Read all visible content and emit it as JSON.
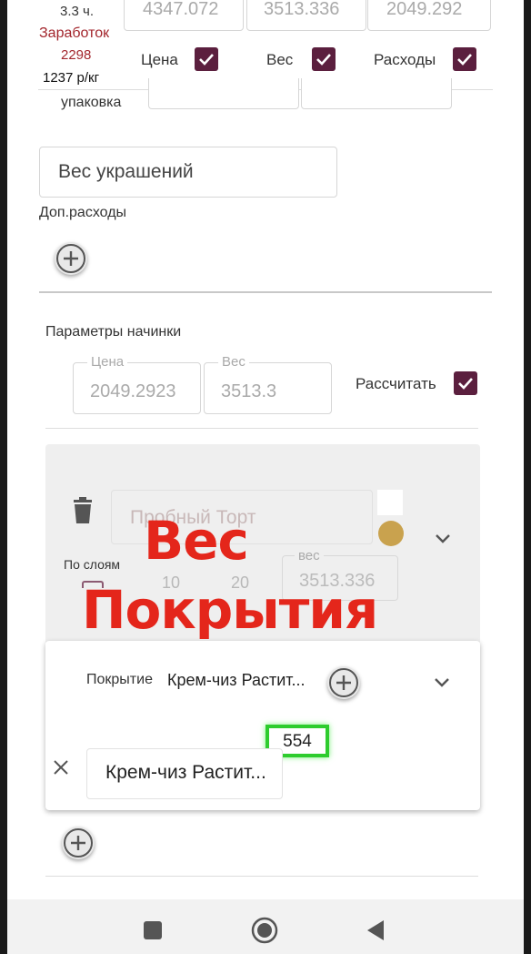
{
  "top": {
    "hours": "3.3 ч.",
    "earnings_label": "Заработок",
    "earnings_value": "2298",
    "price_per_kg": "1237 р/кг",
    "field_1": "4347.072",
    "field_2": "3513.336",
    "field_3": "2049.292",
    "check_price": "Цена",
    "check_weight": "Вес",
    "check_expenses": "Расходы",
    "packaging_label": "упаковка"
  },
  "decorations": {
    "placeholder": "Вес украшений",
    "extra_expenses_label": "Доп.расходы"
  },
  "filling": {
    "section_title": "Параметры начинки",
    "price_legend": "Цена",
    "price_value": "2049.2923",
    "weight_legend": "Вес",
    "weight_value": "3513.3",
    "calculate_label": "Рассчитать"
  },
  "cake_card": {
    "name": "Пробный Торт",
    "by_layers_label": "По слоям",
    "layer_a": "10",
    "layer_b": "20",
    "weight_legend": "вес",
    "weight_value": "3513.336",
    "accent_color": "#c9a24e"
  },
  "coating_card": {
    "label": "Покрытие",
    "selected": "Крем-чиз Растит...",
    "weight_badge": "554",
    "item_name": "Крем-чиз Растит..."
  },
  "overlay": {
    "line1": "Вес",
    "line2": "Покрытия"
  },
  "colors": {
    "checkbox": "#5b1f3e",
    "earnings": "#a3262d",
    "overlay": "#e4261b",
    "badge_border": "#2ecc2e"
  },
  "navbar": {
    "icons": [
      "square-icon",
      "home-circle-icon",
      "back-triangle-icon"
    ]
  }
}
